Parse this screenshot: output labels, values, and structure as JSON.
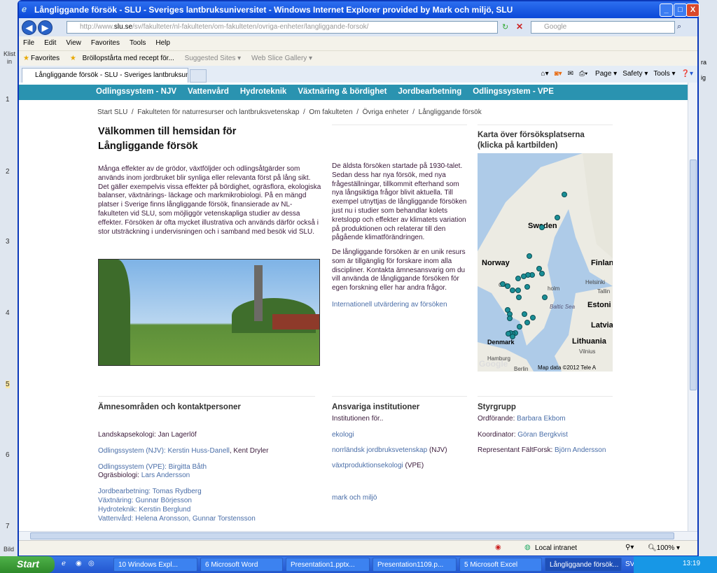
{
  "ppt": {
    "ruler": [
      "1",
      "2",
      "3",
      "4",
      "5",
      "6",
      "7"
    ],
    "left_labels": [
      "Klist",
      "in",
      "Bild"
    ],
    "right_labels": [
      "ra",
      "ig"
    ]
  },
  "window": {
    "title": "Långliggande försök - SLU - Sveriges lantbruksuniversitet - Windows Internet Explorer provided by Mark och miljö, SLU",
    "minimize": "_",
    "maximize": "□",
    "close": "X"
  },
  "address": {
    "prefix": "http://www.",
    "domain": "slu.se",
    "path": "/sv/fakulteter/nl-fakulteten/om-fakulteten/ovriga-enheter/langliggande-forsok/",
    "search_placeholder": "Google"
  },
  "menu": [
    "File",
    "Edit",
    "View",
    "Favorites",
    "Tools",
    "Help"
  ],
  "favorites": {
    "label": "Favorites",
    "items": [
      "Bröllopstårta med recept för...",
      "Suggested Sites ▾",
      "Web Slice Gallery ▾"
    ]
  },
  "tab": {
    "label": "Långliggande försök - SLU - Sveriges lantbruksuniversi..."
  },
  "toolbar": [
    "Page ▾",
    "Safety ▾",
    "Tools ▾"
  ],
  "topnav": [
    "Odlingssystem - NJV",
    "Vattenvård",
    "Hydroteknik",
    "Växtnäring & bördighet",
    "Jordbearbetning",
    "Odlingssystem - VPE"
  ],
  "breadcrumb": [
    "Start SLU",
    "Fakulteten för naturresurser och lantbruksvetenskap",
    "Om fakulteten",
    "Övriga enheter",
    "Långliggande försök"
  ],
  "main": {
    "title_line1": "Välkommen till hemsidan för",
    "title_line2": "Långliggande försök",
    "intro": "Många effekter av de grödor, växtföljder och odlingsåtgärder som används inom jordbruket blir synliga eller relevanta först på lång sikt. Det gäller exempelvis vissa effekter på bördighet, ogräsflora, ekologiska balanser, växtnärings- läckage och markmikrobiologi. På en mängd platser i Sverige finns långliggande försök, finansierade av NL-fakulteten vid SLU, som möjliggör vetenskapliga studier av dessa effekter. Försöken är ofta mycket illustrativa och används därför också i stor utsträckning i undervisningen och i samband med besök vid SLU.",
    "p2": " De äldsta försöken startade på 1930-talet. Sedan dess har nya försök, med nya frågeställningar, tillkommit efterhand som nya långsiktiga frågor blivit aktuella. Till exempel utnyttjas de långliggande försöken just nu i studier som behandlar kolets kretslopp och effekter av klimatets variation på produktionen och relaterar till den pågående klimatförändringen.",
    "p3": "De långliggande försöken är en unik resurs som är tillgänglig för forskare inom alla discipliner. Kontakta ämnesansvarig om du vill använda de långliggande försöken för egen forskning eller har andra frågor.",
    "link": "Internationell utvärdering av försöken"
  },
  "map": {
    "title_line1": "Karta över försöksplatserna",
    "title_line2": "(klicka på kartbilden)",
    "labels": {
      "sweden": "Sweden",
      "norway": "Norway",
      "finland": "Finlan",
      "estonia": "Estoni",
      "latvia": "Latvia",
      "lithuania": "Lithuania",
      "denmark": "Denmark",
      "oslo": "Oslo",
      "helsinki": "Helsinki",
      "tallinn": "Tallin",
      "baltic": "Baltic Sea",
      "vilnius": "Vilnius",
      "hamburg": "Hamburg",
      "berlin": "Berlin",
      "stockholm": "holm"
    },
    "credit": "Map data ©2012 Tele A",
    "logo": "Google",
    "marker_color": "#1a8f96"
  },
  "subjects": {
    "title": "Ämnesområden och kontaktpersoner",
    "items": [
      {
        "label": "Landskapsekologi: ",
        "name": "Jan Lagerlöf",
        "label_link": false,
        "name_link": false
      },
      {
        "label": "Odlingssystem (NJV): Kerstin Huss-Danell",
        "name": ", Kent Dryler",
        "label_link": true,
        "name_link": false
      },
      {
        "label": "Odlingssystem (VPE): Birgitta Båth",
        "name": "",
        "label_link": true
      },
      {
        "label": "Ogräsbiologi: ",
        "name": "Lars Andersson",
        "label_link": false,
        "name_link": true
      },
      {
        "label": "Jordbearbetning: Tomas Rydberg",
        "name": "",
        "label_link": true
      },
      {
        "label": "Växtnäring: Gunnar Börjesson",
        "name": "",
        "label_link": true
      },
      {
        "label": "Hydroteknik: Kerstin Berglund",
        "name": "",
        "label_link": true
      },
      {
        "label": "Vattenvård: Helena Aronsson, Gunnar Torstensson",
        "name": "",
        "label_link": true
      }
    ]
  },
  "institutions": {
    "title": "Ansvariga institutioner",
    "intro": "Institutionen för..",
    "items": [
      {
        "link": "ekologi",
        "suffix": ""
      },
      {
        "link": "norrländsk jordbruksvetenskap",
        "suffix": " (NJV)"
      },
      {
        "link": "växtproduktionsekologi",
        "suffix": " (VPE)"
      },
      {
        "link": "mark och miljö",
        "suffix": ""
      }
    ]
  },
  "steering": {
    "title": "Styrgrupp",
    "items": [
      {
        "role": "Ordförande: ",
        "name": "Barbara Ekbom"
      },
      {
        "role": "Koordinator: ",
        "name": "Göran Bergkvist"
      },
      {
        "role": "Representant FältForsk: ",
        "name": "Björn Andersson"
      }
    ]
  },
  "status": {
    "zone": "Local intranet",
    "zoom": "100%"
  },
  "taskbar": {
    "start": "Start",
    "tasks": [
      "10 Windows Expl...",
      "6 Microsoft Word",
      "Presentation1.pptx...",
      "Presentation1109.p...",
      "5 Microsoft Excel",
      "Långliggande försök..."
    ],
    "lang": "SV",
    "time": "13:19"
  }
}
